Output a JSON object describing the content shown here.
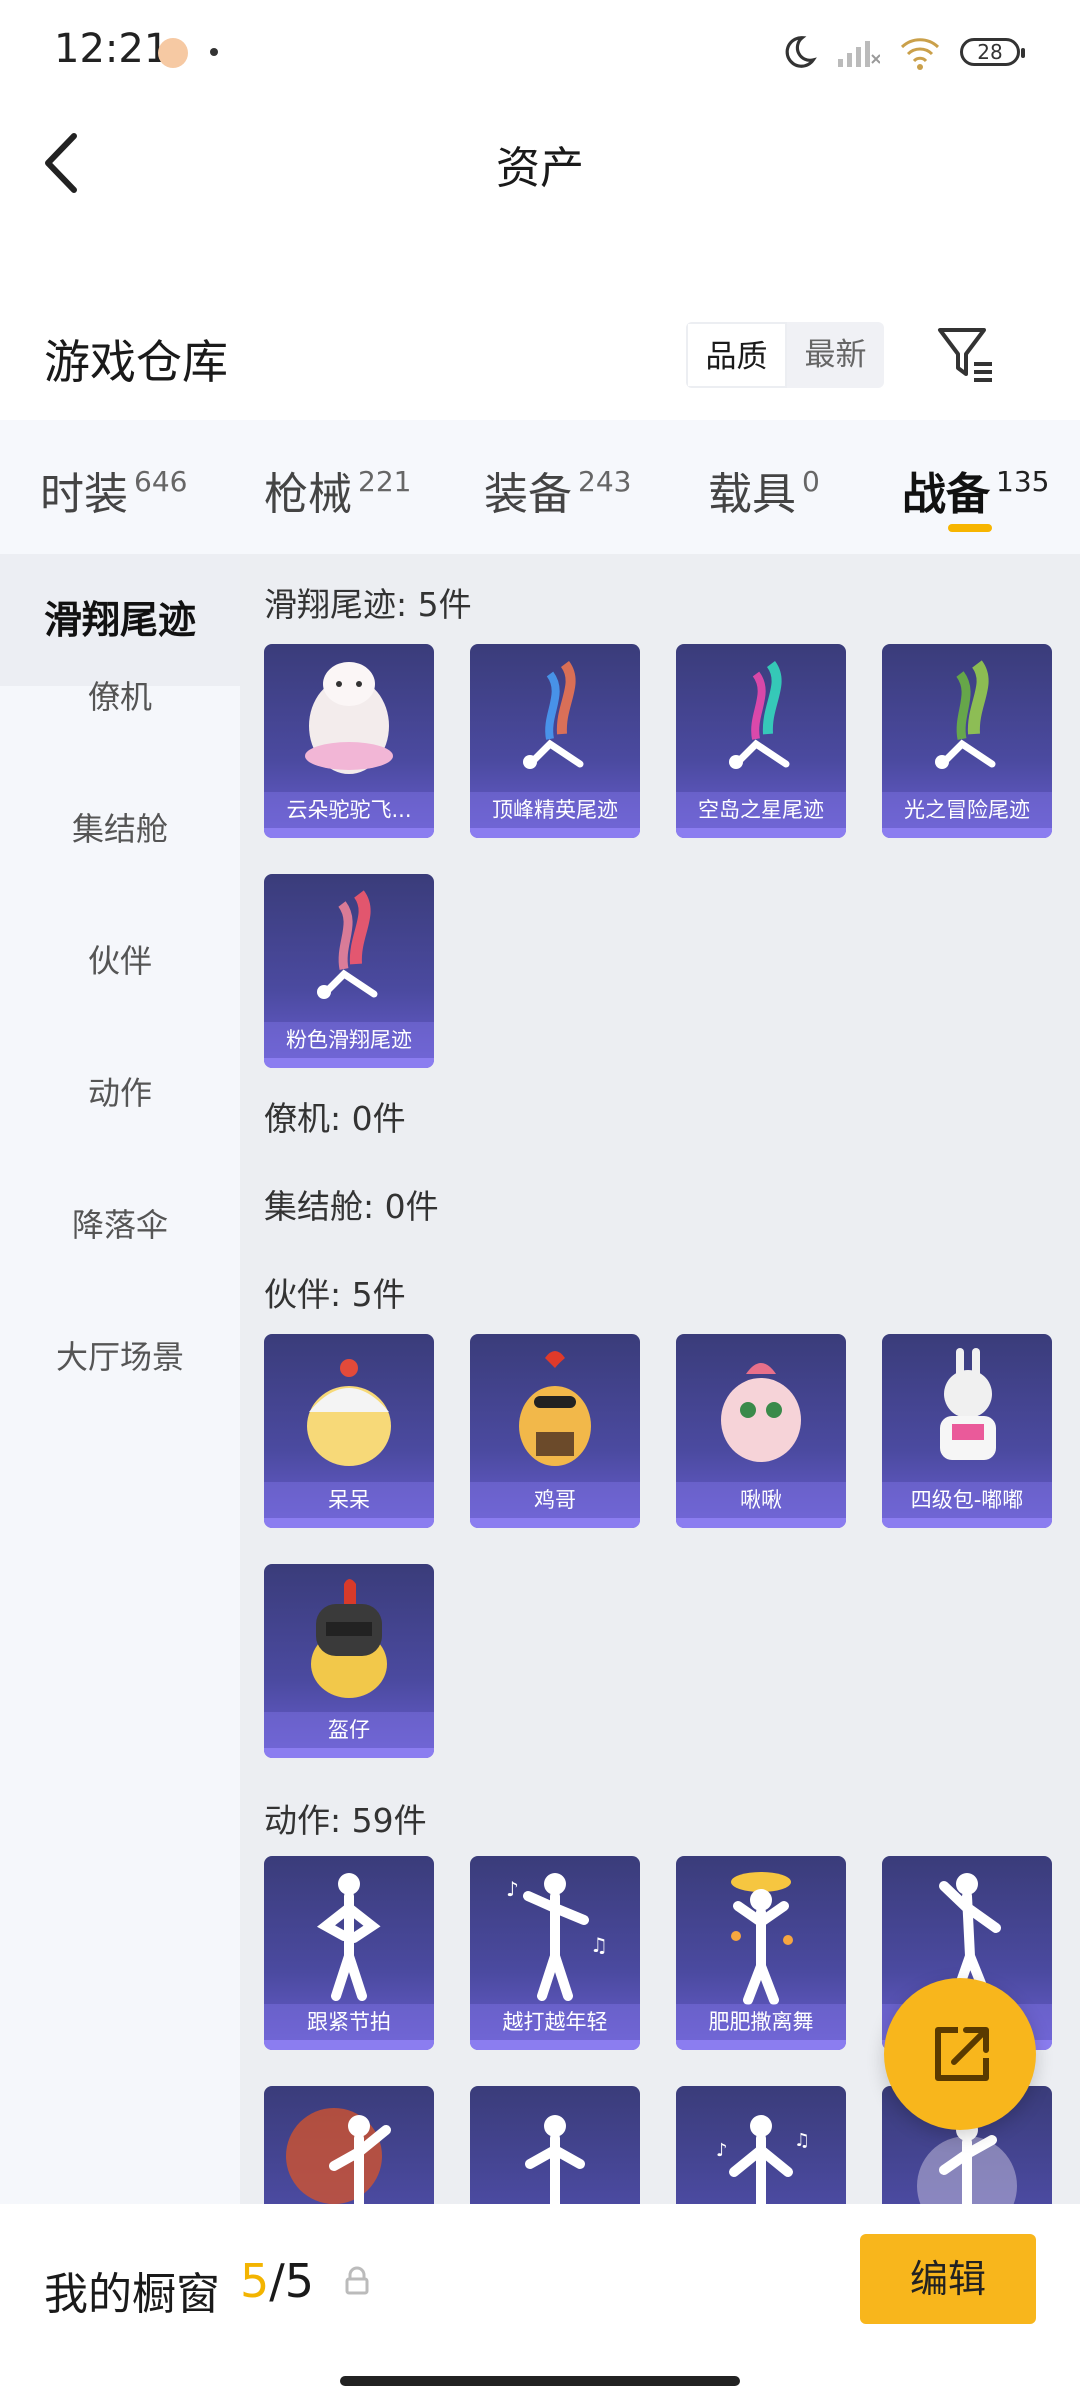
{
  "status_bar": {
    "time": "12:21",
    "battery": "28"
  },
  "nav": {
    "title": "资产"
  },
  "warehouse": {
    "title": "游戏仓库",
    "sort_options": [
      "品质",
      "最新"
    ]
  },
  "tabs": [
    {
      "label": "时装",
      "count": "646"
    },
    {
      "label": "枪械",
      "count": "221"
    },
    {
      "label": "装备",
      "count": "243"
    },
    {
      "label": "载具",
      "count": "0"
    },
    {
      "label": "战备",
      "count": "135"
    }
  ],
  "side_menu": [
    "滑翔尾迹",
    "僚机",
    "集结舱",
    "伙伴",
    "动作",
    "降落伞",
    "大厅场景"
  ],
  "sections": {
    "glide_trails": {
      "title": "滑翔尾迹: 5件",
      "items": [
        "云朵驼驼飞...",
        "顶峰精英尾迹",
        "空岛之星尾迹",
        "光之冒险尾迹",
        "粉色滑翔尾迹"
      ]
    },
    "wingman": {
      "title": "僚机: 0件"
    },
    "pod": {
      "title": "集结舱: 0件"
    },
    "partners": {
      "title": "伙伴: 5件",
      "items": [
        "呆呆",
        "鸡哥",
        "啾啾",
        "四级包-嘟嘟",
        "盔仔"
      ]
    },
    "actions": {
      "title": "动作: 59件",
      "items": [
        "跟紧节拍",
        "越打越年轻",
        "肥肥撒离舞",
        ""
      ]
    }
  },
  "bottom_bar": {
    "label": "我的橱窗",
    "current": "5",
    "total": "/5",
    "edit_label": "编辑"
  },
  "colors": {
    "accent": "#f8b61c",
    "card_bg": "#4b4aa0"
  }
}
